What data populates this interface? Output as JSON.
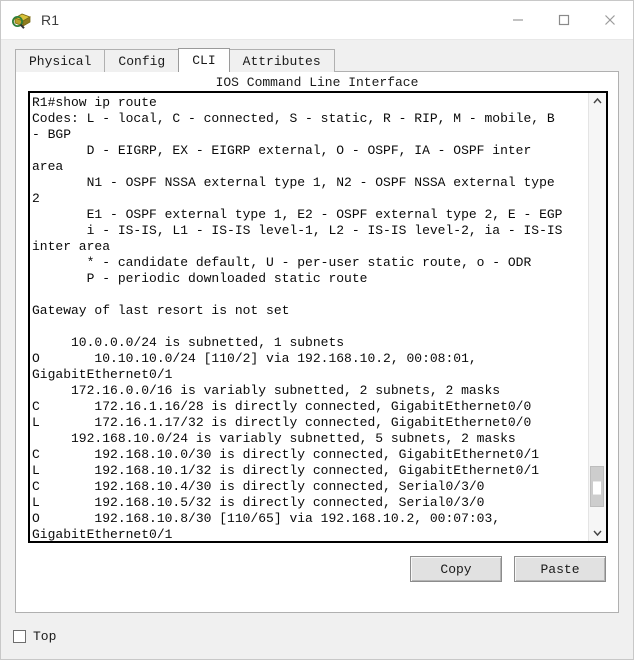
{
  "window": {
    "title": "R1",
    "icon": "router-icon",
    "controls": {
      "minimize": "minimize-icon",
      "maximize": "maximize-icon",
      "close": "close-icon"
    }
  },
  "tabs": [
    {
      "label": "Physical",
      "active": false
    },
    {
      "label": "Config",
      "active": false
    },
    {
      "label": "CLI",
      "active": true
    },
    {
      "label": "Attributes",
      "active": false
    }
  ],
  "panel": {
    "heading": "IOS Command Line Interface"
  },
  "terminal": {
    "text": "R1#show ip route\nCodes: L - local, C - connected, S - static, R - RIP, M - mobile, B\n- BGP\n       D - EIGRP, EX - EIGRP external, O - OSPF, IA - OSPF inter\narea\n       N1 - OSPF NSSA external type 1, N2 - OSPF NSSA external type\n2\n       E1 - OSPF external type 1, E2 - OSPF external type 2, E - EGP\n       i - IS-IS, L1 - IS-IS level-1, L2 - IS-IS level-2, ia - IS-IS\ninter area\n       * - candidate default, U - per-user static route, o - ODR\n       P - periodic downloaded static route\n\nGateway of last resort is not set\n\n     10.0.0.0/24 is subnetted, 1 subnets\nO       10.10.10.0/24 [110/2] via 192.168.10.2, 00:08:01,\nGigabitEthernet0/1\n     172.16.0.0/16 is variably subnetted, 2 subnets, 2 masks\nC       172.16.1.16/28 is directly connected, GigabitEthernet0/0\nL       172.16.1.17/32 is directly connected, GigabitEthernet0/0\n     192.168.10.0/24 is variably subnetted, 5 subnets, 2 masks\nC       192.168.10.0/30 is directly connected, GigabitEthernet0/1\nL       192.168.10.1/32 is directly connected, GigabitEthernet0/1\nC       192.168.10.4/30 is directly connected, Serial0/3/0\nL       192.168.10.5/32 is directly connected, Serial0/3/0\nO       192.168.10.8/30 [110/65] via 192.168.10.2, 00:07:03,\nGigabitEthernet0/1"
  },
  "scrollbar": {
    "up_icon": "chevron-up-icon",
    "down_icon": "chevron-down-icon",
    "thumb_top_pct": 86,
    "thumb_height_pct": 10
  },
  "buttons": {
    "copy": "Copy",
    "paste": "Paste"
  },
  "footer": {
    "top_checkbox_label": "Top",
    "top_checkbox_checked": false
  },
  "colors": {
    "window_bg": "#f0f0f0",
    "panel_bg": "#ffffff",
    "terminal_border": "#000000",
    "terminal_text": "#0a0a0a",
    "button_face": "#e1e1e1",
    "tab_inactive": "#f0f0f0",
    "tab_active": "#ffffff"
  }
}
